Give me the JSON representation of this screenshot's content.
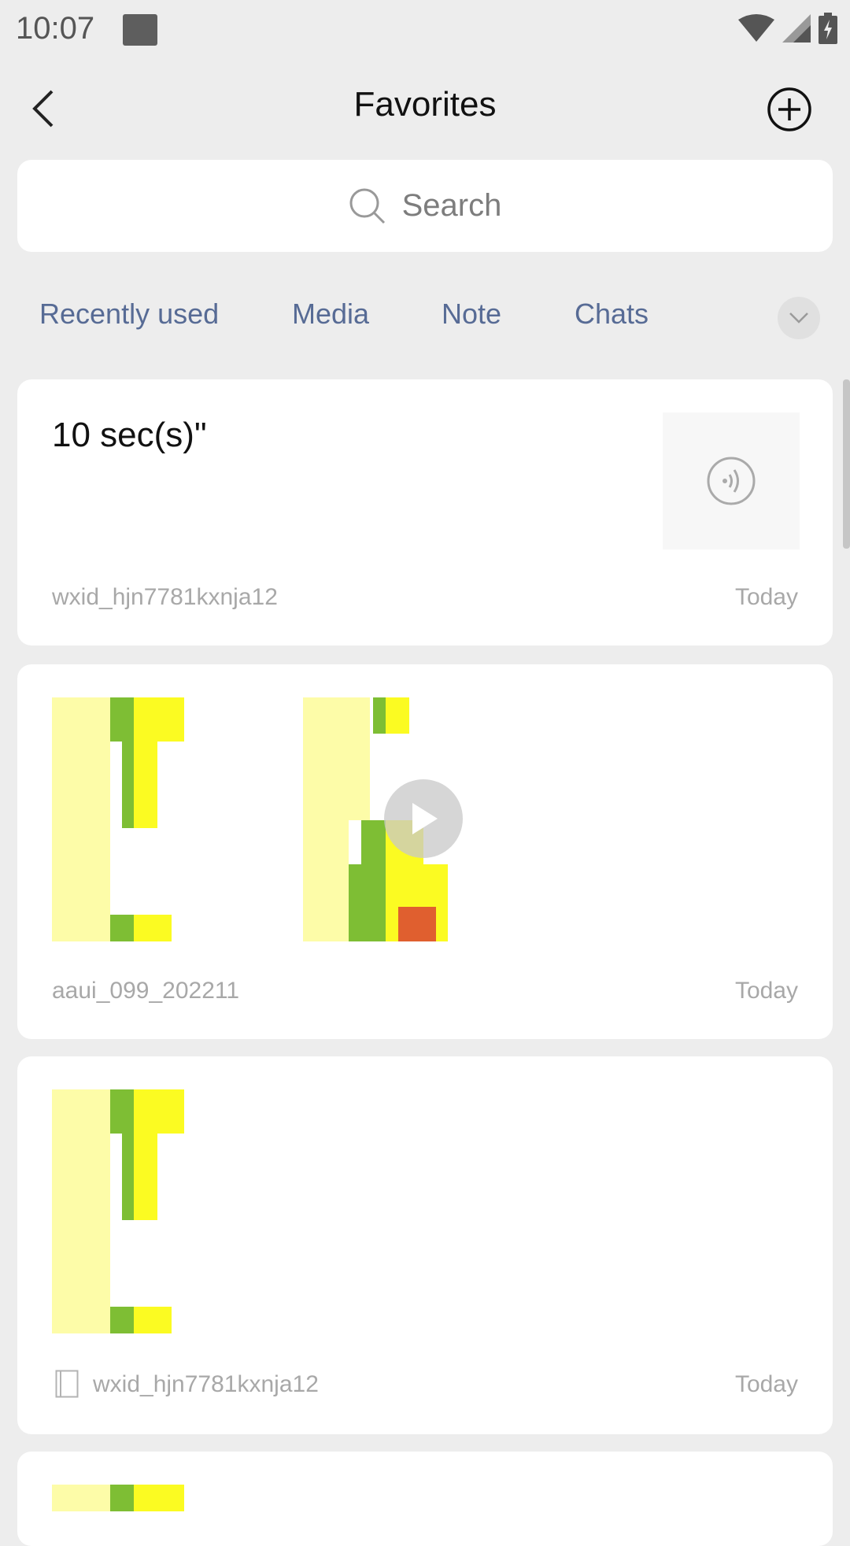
{
  "status": {
    "time": "10:07"
  },
  "header": {
    "title": "Favorites"
  },
  "search": {
    "placeholder": "Search"
  },
  "tabs": [
    {
      "label": "Recently used"
    },
    {
      "label": "Media"
    },
    {
      "label": "Note"
    },
    {
      "label": "Chats"
    }
  ],
  "cards": [
    {
      "text": "10 sec(s)\"",
      "source": "wxid_hjn7781kxnja12",
      "date": "Today"
    },
    {
      "source": "aaui_099_202211",
      "date": "Today"
    },
    {
      "source": "wxid_hjn7781kxnja12",
      "date": "Today"
    }
  ],
  "colors": {
    "pale_yellow": "#fdfca8",
    "yellow": "#fbfb22",
    "green": "#7ebe34",
    "orange": "#e05f2f",
    "link": "#576b95"
  }
}
